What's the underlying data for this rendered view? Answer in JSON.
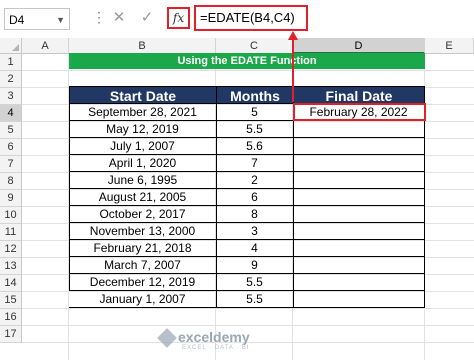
{
  "formula_bar": {
    "name_box": "D4",
    "fx_label": "fx",
    "cancel_icon": "✕",
    "enter_icon": "✓",
    "formula": "=EDATE(B4,C4)"
  },
  "columns": [
    "A",
    "B",
    "C",
    "D",
    "E"
  ],
  "rows": [
    "1",
    "2",
    "3",
    "4",
    "5",
    "6",
    "7",
    "8",
    "9",
    "10",
    "11",
    "12",
    "13",
    "14",
    "15",
    "16",
    "17"
  ],
  "title_band": "Using the EDATE Function",
  "table": {
    "headers": [
      "Start Date",
      "Months",
      "Final Date"
    ],
    "rows": [
      {
        "start": "September 28, 2021",
        "months": "5",
        "final": "February 28, 2022"
      },
      {
        "start": "May 12, 2019",
        "months": "5.5",
        "final": ""
      },
      {
        "start": "July 1, 2007",
        "months": "5.6",
        "final": ""
      },
      {
        "start": "April 1, 2020",
        "months": "7",
        "final": ""
      },
      {
        "start": "June 6, 1995",
        "months": "2",
        "final": ""
      },
      {
        "start": "August 21, 2005",
        "months": "6",
        "final": ""
      },
      {
        "start": "October 2, 2017",
        "months": "8",
        "final": ""
      },
      {
        "start": "November 13, 2000",
        "months": "3",
        "final": ""
      },
      {
        "start": "February 21, 2018",
        "months": "4",
        "final": ""
      },
      {
        "start": "March 7, 2007",
        "months": "9",
        "final": ""
      },
      {
        "start": "December 12, 2019",
        "months": "5.5",
        "final": ""
      },
      {
        "start": "January 1, 2007",
        "months": "5.5",
        "final": ""
      }
    ]
  },
  "watermark": {
    "name": "exceldemy",
    "sub": "EXCEL · DATA · BI"
  },
  "colors": {
    "title_band": "#1ba84b",
    "table_header": "#223864",
    "highlight": "#e0212b"
  }
}
